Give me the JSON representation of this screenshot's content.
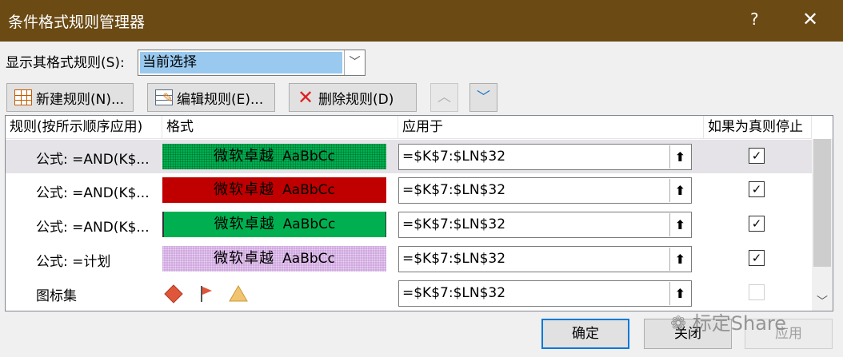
{
  "window": {
    "title": "条件格式规则管理器",
    "help_glyph": "?",
    "close_glyph": "✕"
  },
  "scope": {
    "label": "显示其格式规则(S):",
    "value": "当前选择"
  },
  "toolbar": {
    "new_rule": "新建规则(N)...",
    "edit_rule": "编辑规则(E)...",
    "delete_rule": "删除规则(D)"
  },
  "headers": {
    "rule": "规则(按所示顺序应用)",
    "format": "格式",
    "applies_to": "应用于",
    "stop_if_true": "如果为真则停止"
  },
  "rules": [
    {
      "rule": "公式: =AND(K$...",
      "preview_text": "微软卓越",
      "preview_abc": "AaBbCc",
      "fill": "#00b050",
      "applies_to": "=$K$7:$LN$32",
      "stop": true,
      "selected": true
    },
    {
      "rule": "公式: =AND(K$...",
      "preview_text": "微软卓越",
      "preview_abc": "AaBbCc",
      "fill": "#c00000",
      "applies_to": "=$K$7:$LN$32",
      "stop": true,
      "selected": false
    },
    {
      "rule": "公式: =AND(K$...",
      "preview_text": "微软卓越",
      "preview_abc": "AaBbCc",
      "fill": "#00b050",
      "applies_to": "=$K$7:$LN$32",
      "stop": true,
      "selected": false
    },
    {
      "rule": "公式: =计划",
      "preview_text": "微软卓越",
      "preview_abc": "AaBbCc",
      "fill": "#d0a8e0",
      "applies_to": "=$K$7:$LN$32",
      "stop": true,
      "selected": false
    },
    {
      "rule": "图标集",
      "icons": [
        "red-diamond-icon",
        "red-flag-icon",
        "yellow-triangle-icon"
      ],
      "applies_to": "=$K$7:$LN$32",
      "stop": false,
      "selected": false
    }
  ],
  "buttons": {
    "ok": "确定",
    "close": "关闭",
    "apply": "应用"
  },
  "watermark": "标定Share",
  "colors": {
    "titlebar": "#6b4a14",
    "selection": "#99c9ef",
    "accent": "#0078d7"
  }
}
